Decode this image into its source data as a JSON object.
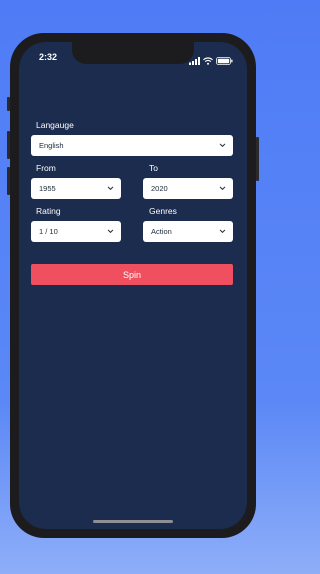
{
  "status_bar": {
    "time": "2:32"
  },
  "form": {
    "language": {
      "label": "Langauge",
      "value": "English"
    },
    "from": {
      "label": "From",
      "value": "1955"
    },
    "to": {
      "label": "To",
      "value": "2020"
    },
    "rating": {
      "label": "Rating",
      "value": "1 / 10"
    },
    "genres": {
      "label": "Genres",
      "value": "Action"
    },
    "spin_label": "Spin"
  },
  "colors": {
    "background": "#4f7cf6",
    "screen": "#1b2c4e",
    "spin_button": "#ef4f5f"
  }
}
